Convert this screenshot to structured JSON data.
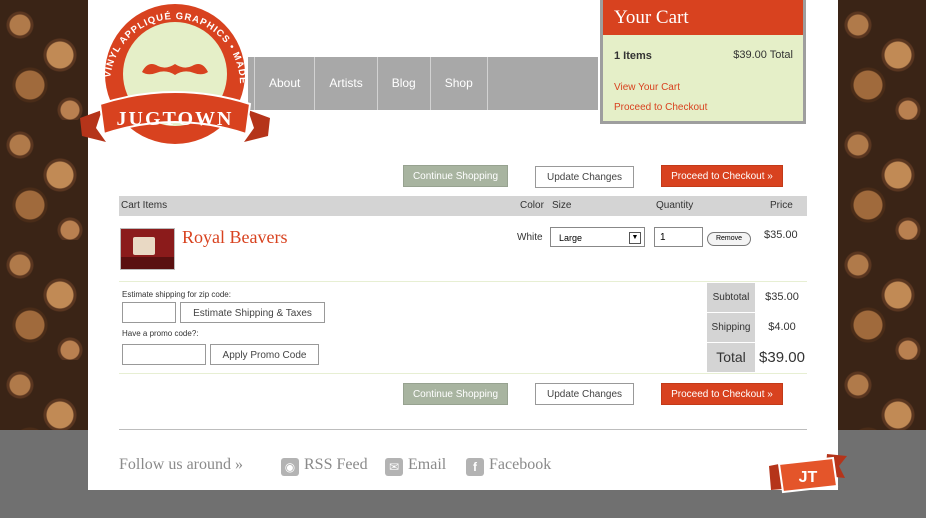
{
  "brand": {
    "name": "JUGTOWN",
    "ring_text": "VINYL APPLIQUÉ GRAPHICS • MADE TO ORDER",
    "badge": "JT",
    "colors": {
      "accent": "#d8421f",
      "cart_bg": "#e5efc8",
      "nav_bg": "#a8a8a8"
    }
  },
  "nav": {
    "items": [
      "About",
      "Artists",
      "Blog",
      "Shop"
    ]
  },
  "mini_cart": {
    "title": "Your Cart",
    "items": "1 Items",
    "total": "$39.00 Total",
    "view_link": "View Your Cart",
    "checkout_link": "Proceed to Checkout"
  },
  "buttons": {
    "continue": "Continue Shopping",
    "update": "Update Changes",
    "checkout": "Proceed to Checkout »"
  },
  "table": {
    "headers": {
      "items": "Cart Items",
      "color": "Color",
      "size": "Size",
      "quantity": "Quantity",
      "price": "Price"
    },
    "rows": [
      {
        "name": "Royal Beavers",
        "color": "White",
        "size": "Large",
        "quantity": "1",
        "remove": "Remove",
        "price": "$35.00"
      }
    ]
  },
  "shipping": {
    "zip_label": "Estimate shipping for zip code:",
    "zip_button": "Estimate Shipping & Taxes",
    "promo_label": "Have a promo code?:",
    "promo_button": "Apply Promo Code"
  },
  "totals": {
    "subtotal_label": "Subtotal",
    "subtotal": "$35.00",
    "shipping_label": "Shipping",
    "shipping": "$4.00",
    "total_label": "Total",
    "total": "$39.00"
  },
  "footer": {
    "follow": "Follow us around »",
    "links": [
      {
        "label": "RSS Feed",
        "icon": "rss-icon"
      },
      {
        "label": "Email",
        "icon": "email-icon"
      },
      {
        "label": "Facebook",
        "icon": "facebook-icon"
      }
    ]
  }
}
